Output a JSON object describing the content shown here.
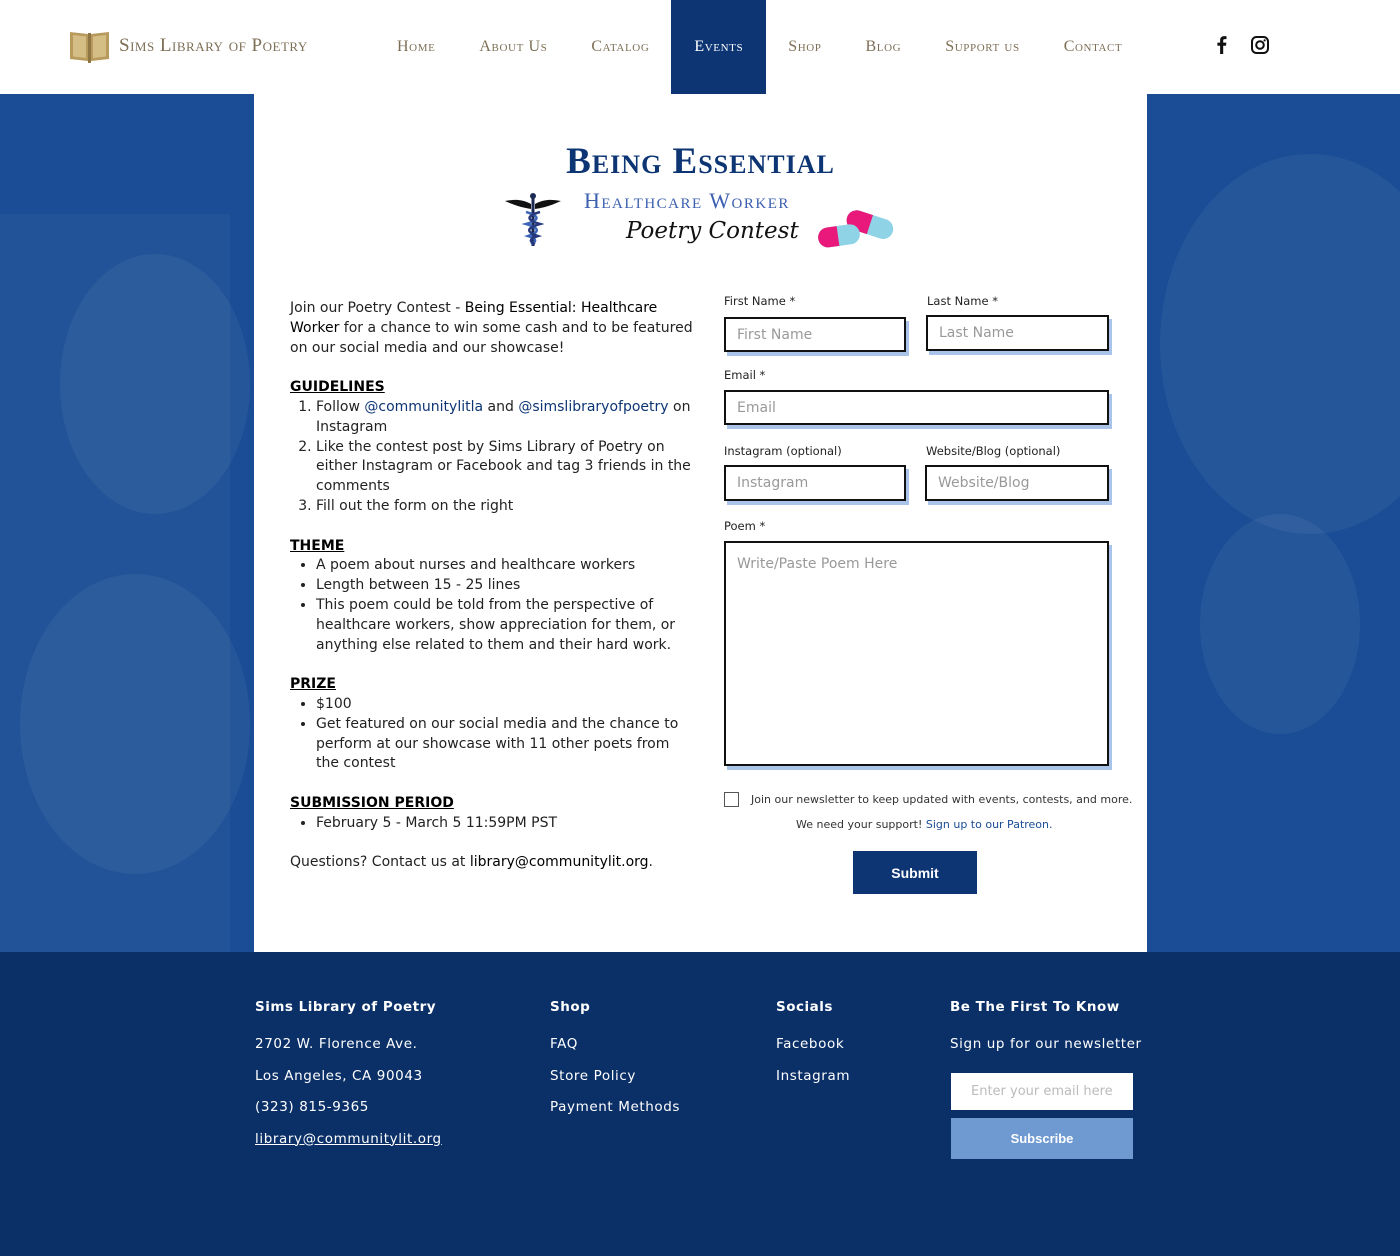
{
  "header": {
    "brand": "Sims Library of Poetry",
    "nav": [
      {
        "label": "Home"
      },
      {
        "label": "About Us"
      },
      {
        "label": "Catalog"
      },
      {
        "label": "Events"
      },
      {
        "label": "Shop"
      },
      {
        "label": "Blog"
      },
      {
        "label": "Support us"
      },
      {
        "label": "Contact"
      }
    ],
    "active_nav": "Events",
    "social_icons": [
      "facebook-icon",
      "instagram-icon"
    ]
  },
  "contest": {
    "title": "Being Essential",
    "subtitle": "Healthcare Worker",
    "tagline": "Poetry Contest",
    "intro_pre": "Join our Poetry Contest - ",
    "intro_bold": "Being Essential: Healthcare Worker",
    "intro_post": " for a chance to win some cash and to be featured on our social media and our showcase!",
    "guidelines_heading": "GUIDELINES",
    "guideline_1_pre": "Follow ",
    "guideline_1_link1": "@communitylitla",
    "guideline_1_mid": " and ",
    "guideline_1_link2": "@simslibraryofpoetry",
    "guideline_1_post": " on Instagram",
    "guideline_2": "Like the contest post by Sims Library of Poetry on either Instagram or Facebook and tag 3 friends in the comments",
    "guideline_3": "Fill out the form on the right",
    "theme_heading": "THEME",
    "theme": [
      "A poem about nurses and healthcare workers",
      "Length between 15 - 25 lines",
      "This poem could be told from the perspective of healthcare workers, show appreciation for them, or anything else related to them and their hard work."
    ],
    "prize_heading": "PRIZE",
    "prize": [
      "$100",
      "Get featured on our social media and the chance to perform at our showcase with 11 other poets from the contest"
    ],
    "period_heading": "SUBMISSION PERIOD",
    "period": [
      "February 5 - March 5 11:59PM PST"
    ],
    "questions_pre": "Questions? Contact us at ",
    "questions_email": "library@communitylit.org",
    "questions_post": "."
  },
  "form": {
    "first_name_label": "First Name *",
    "first_name_placeholder": "First Name",
    "last_name_label": "Last Name *",
    "last_name_placeholder": "Last Name",
    "email_label": "Email *",
    "email_placeholder": "Email",
    "instagram_label": "Instagram (optional)",
    "instagram_placeholder": "Instagram",
    "website_label": "Website/Blog (optional)",
    "website_placeholder": "Website/Blog",
    "poem_label": "Poem *",
    "poem_placeholder": "Write/Paste Poem Here",
    "newsletter_label": "Join our newsletter to keep updated with events, contests, and more.",
    "support_pre": "We need your support! ",
    "support_link": "Sign up to our Patreon.",
    "submit_label": "Submit"
  },
  "footer": {
    "col1_heading": "Sims Library of Poetry",
    "col1_lines": [
      "2702 W. Florence Ave.",
      "Los Angeles, CA 90043",
      "(323) 815-9365"
    ],
    "col1_email": "library@communitylit.org",
    "col2_heading": "Shop",
    "col2_links": [
      "FAQ",
      "Store Policy",
      "Payment Methods"
    ],
    "col3_heading": "Socials",
    "col3_links": [
      "Facebook",
      "Instagram"
    ],
    "col4_heading": "Be The First To Know",
    "col4_text": "Sign up for our newsletter",
    "email_placeholder": "Enter your email here",
    "subscribe_label": "Subscribe"
  },
  "colors": {
    "brand_navy": "#0d3574",
    "hero_blue": "#1a4d95",
    "footer_navy": "#0b3068",
    "gold": "#7d6f56",
    "subscribe_blue": "#6f9ad1",
    "input_shadow": "#a9c4e8",
    "pill_pink": "#e8197a",
    "pill_blue": "#8fd3e6"
  }
}
